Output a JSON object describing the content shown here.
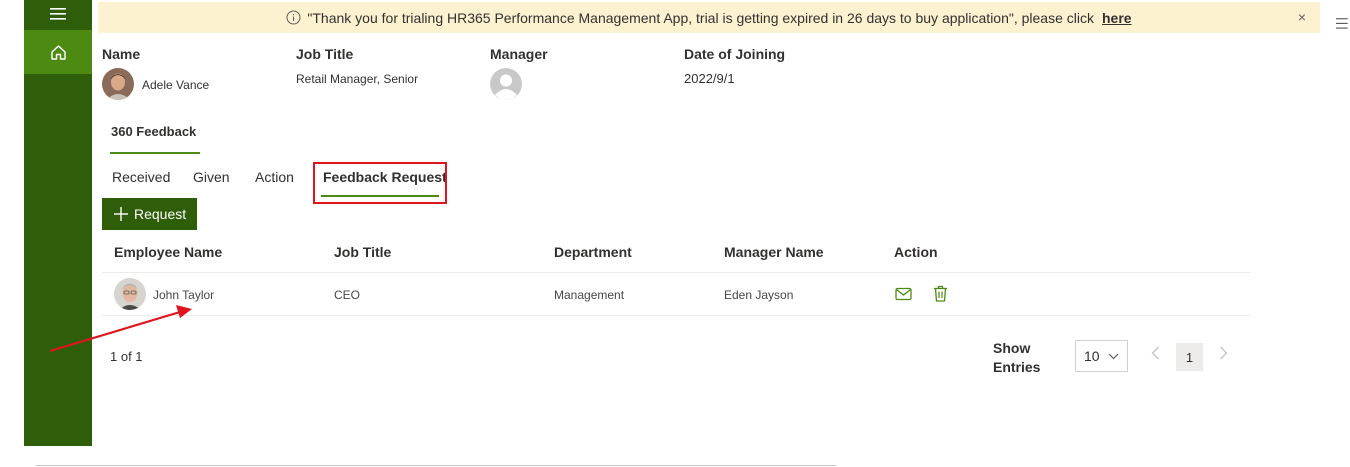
{
  "banner": {
    "message": "\"Thank you for trialing HR365 Performance Management App, trial is getting expired in 26 days to buy application\", please click",
    "link_label": "here",
    "close_glyph": "×"
  },
  "profile": {
    "name_label": "Name",
    "name_value": "Adele Vance",
    "job_title_label": "Job Title",
    "job_title_value": "Retail Manager, Senior",
    "manager_label": "Manager",
    "doj_label": "Date of Joining",
    "doj_value": "2022/9/1"
  },
  "section_tab": "360 Feedback",
  "subtabs": [
    "Received",
    "Given",
    "Action",
    "Feedback Request"
  ],
  "active_subtab": "Feedback Request",
  "request_button": "Request",
  "table": {
    "headers": [
      "Employee Name",
      "Job Title",
      "Department",
      "Manager Name",
      "Action"
    ],
    "rows": [
      {
        "employee": "John Taylor",
        "job_title": "CEO",
        "department": "Management",
        "manager": "Eden Jayson"
      }
    ]
  },
  "pagination": {
    "summary": "1 of 1",
    "show_entries_label": "Show Entries",
    "page_size": "10",
    "current_page": "1"
  },
  "colors": {
    "sidebar": "#2f5e0b",
    "accent": "#4d8a12",
    "banner_bg": "#fdf2d0",
    "annotation": "#e0141d"
  },
  "icons": {
    "menu": "hamburger-icon",
    "home": "home-icon",
    "info": "info-icon",
    "add": "plus-icon",
    "mail": "mail-icon",
    "delete": "trash-icon"
  }
}
